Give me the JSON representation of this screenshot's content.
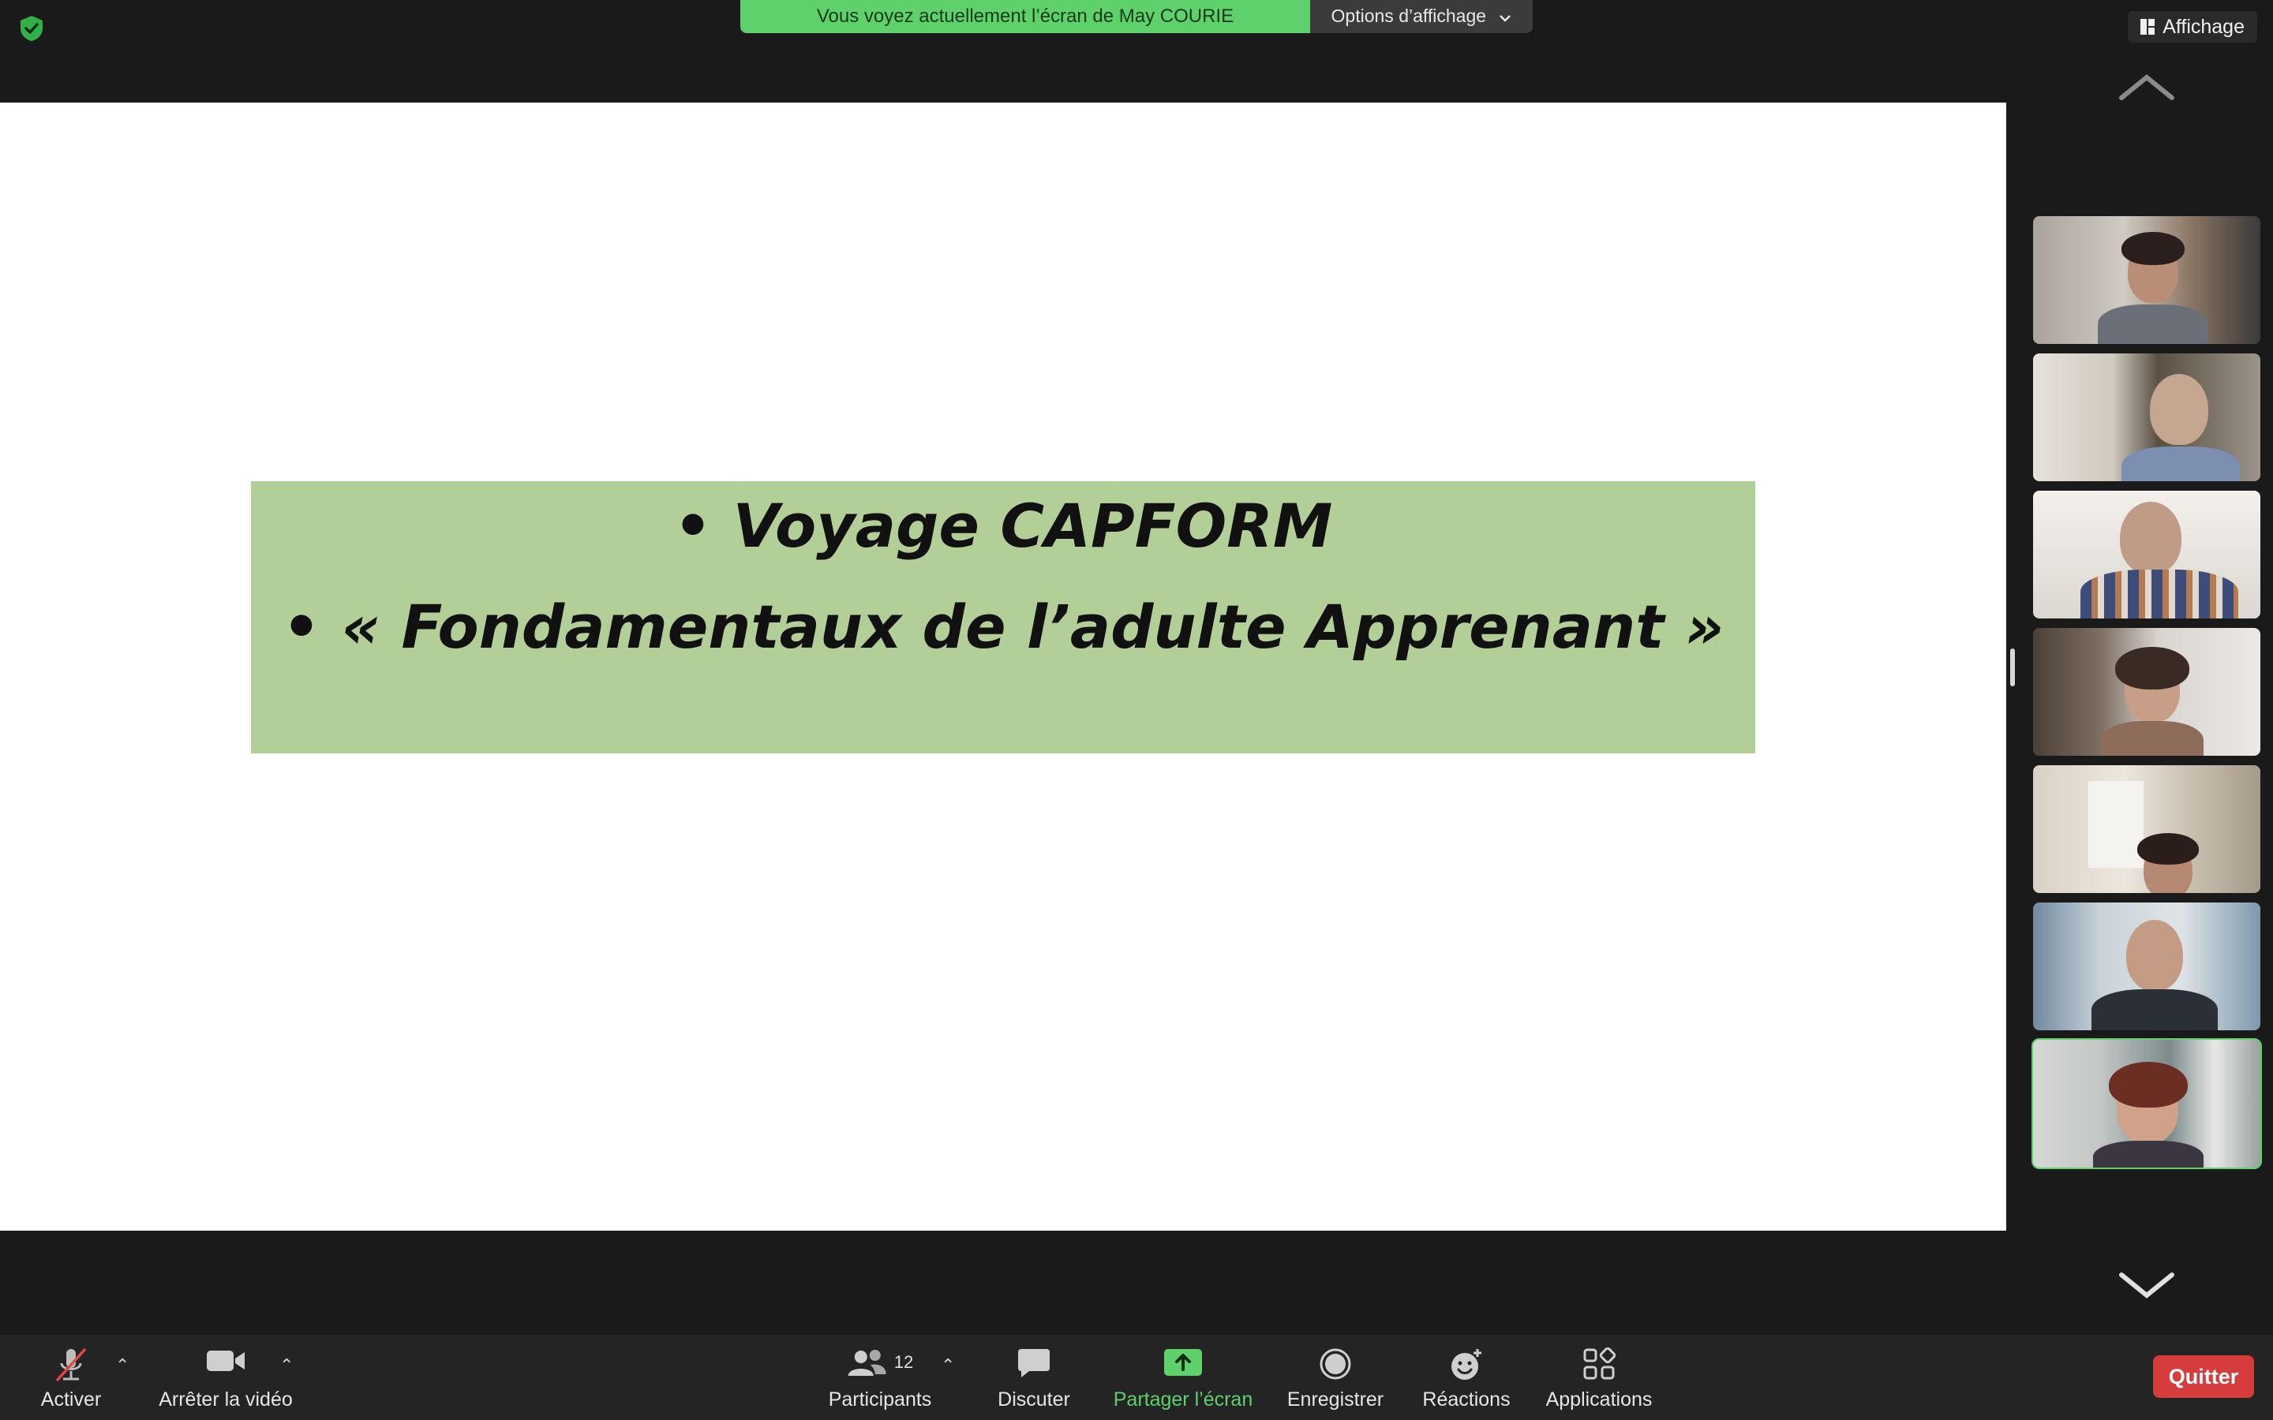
{
  "banner": {
    "text": "Vous voyez actuellement l’écran de May COURIE",
    "options_label": "Options d’affichage"
  },
  "header": {
    "view_label": "Affichage"
  },
  "slide": {
    "line1": "• Voyage CAPFORM",
    "line2": "• « Fondamentaux de l’adulte Apprenant »"
  },
  "toolbar": {
    "mute_label": "Activer",
    "video_label": "Arrêter la vidéo",
    "participants_label": "Participants",
    "participants_count": "12",
    "chat_label": "Discuter",
    "share_label": "Partager l’écran",
    "record_label": "Enregistrer",
    "reactions_label": "Réactions",
    "apps_label": "Applications",
    "quit_label": "Quitter"
  },
  "colors": {
    "accent_green": "#5fd16a",
    "quit_red": "#d63c3c",
    "slide_box": "#b3cf98"
  },
  "icons": [
    "shield-check-icon",
    "grid-icon",
    "chevron-up-icon",
    "chevron-down-icon",
    "mic-muted-icon",
    "video-camera-icon",
    "participants-icon",
    "chat-bubble-icon",
    "share-screen-icon",
    "record-icon",
    "reactions-icon",
    "apps-icon"
  ]
}
